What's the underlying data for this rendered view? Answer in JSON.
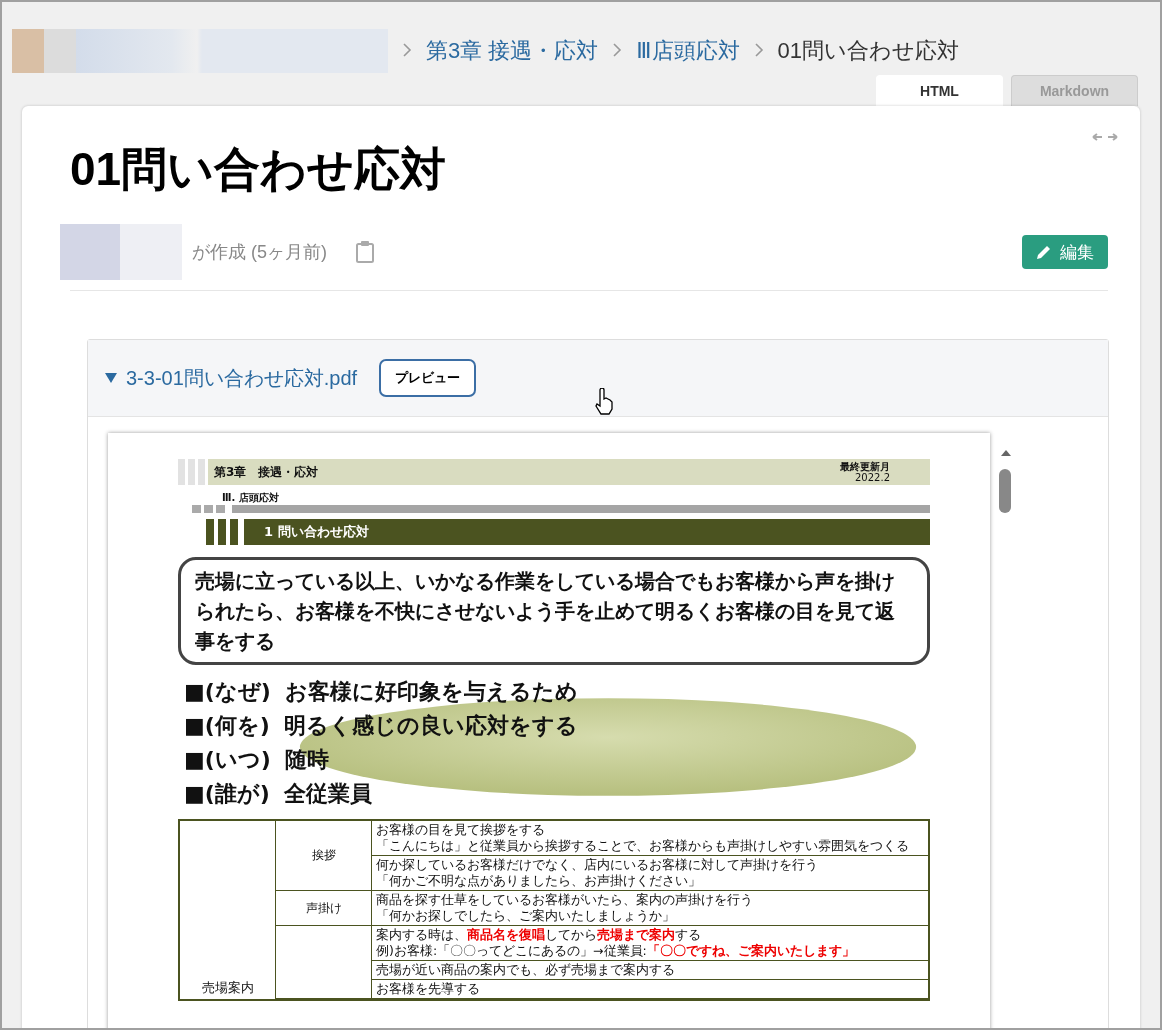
{
  "breadcrumbs": [
    {
      "label": "第3章 接遇・応対",
      "link": true
    },
    {
      "label": "Ⅲ店頭応対",
      "link": true
    },
    {
      "label": "01問い合わせ応対",
      "link": false
    }
  ],
  "view_tabs": [
    {
      "label": "HTML",
      "selected": true
    },
    {
      "label": "Markdown",
      "selected": false
    }
  ],
  "page": {
    "title": "01問い合わせ応対",
    "meta": "が作成 (5ヶ月前)",
    "edit_button": "編集"
  },
  "attachment": {
    "filename": "3-3-01問い合わせ応対.pdf",
    "expanded": true,
    "preview_button": "プレビュー"
  },
  "pdf": {
    "chapter": "第3章　接遇・応対",
    "updated_label": "最終更新月",
    "updated_date": "2022.2",
    "section": "Ⅲ.  店頭応対",
    "heading": "1 問い合わせ応対",
    "summary": "売場に立っている以上、いかなる作業をしている場合でもお客様から声を掛けられたら、お客様を不快にさせないよう手を止めて明るくお客様の目を見て返事をする",
    "points": [
      {
        "label": "■(なぜ)",
        "text": "お客様に好印象を与えるため"
      },
      {
        "label": "■(何を)",
        "text": "明るく感じの良い応対をする"
      },
      {
        "label": "■(いつ)",
        "text": "随時"
      },
      {
        "label": "■(誰が)",
        "text": "全従業員"
      }
    ],
    "table": {
      "category": "売場案内",
      "groups": [
        {
          "label": "挨拶",
          "items": [
            [
              "お客様の目を見て挨拶をする",
              "「こんにちは」と従業員から挨拶することで、お客様からも声掛けしやすい雰囲気をつくる"
            ],
            [
              "何か探しているお客様だけでなく、店内にいるお客様に対して声掛けを行う",
              "「何かご不明な点がありましたら、お声掛けください」"
            ]
          ]
        },
        {
          "label": "声掛け",
          "items": [
            [
              "商品を探す仕草をしているお客様がいたら、案内の声掛けを行う",
              "「何かお探しでしたら、ご案内いたしましょうか」"
            ]
          ]
        },
        {
          "items": [
            [
              "案内する時は、**商品名を復唱**してから**売場まで案内**する",
              "例)お客様:「〇〇ってどこにあるの」→従業員:**「〇〇ですね、ご案内いたします」**"
            ],
            [
              "売場が近い商品の案内でも、必ず売場まで案内する"
            ],
            [
              "お客様を先導する"
            ]
          ]
        }
      ]
    }
  }
}
